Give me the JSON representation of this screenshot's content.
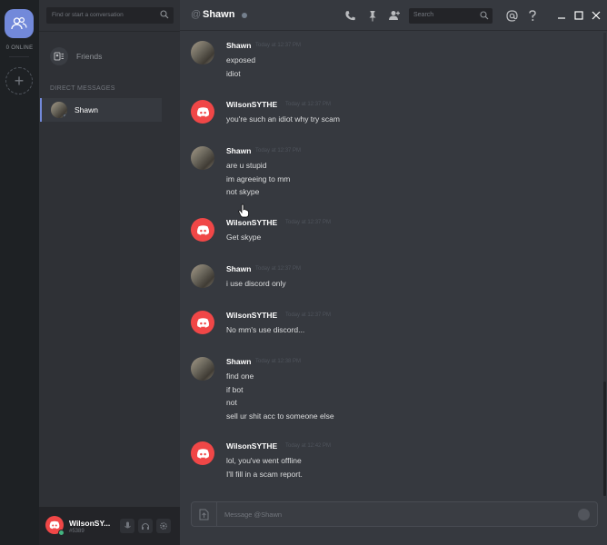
{
  "rail": {
    "online_label": "0 ONLINE",
    "add_server_symbol": "+"
  },
  "dm_panel": {
    "search_placeholder": "Find or start a conversation",
    "friends_label": "Friends",
    "section_header": "DIRECT MESSAGES",
    "dm_items": [
      {
        "label": "Shawn",
        "icon": "user-avatar"
      }
    ]
  },
  "user_panel": {
    "username": "WilsonSY...",
    "tag": "#5389",
    "status_color": "#43b581"
  },
  "header": {
    "at_symbol": "@",
    "channel_name": "Shawn",
    "search_placeholder": "Search",
    "icons": [
      "phone-icon",
      "pin-icon",
      "add-friend-icon",
      "mention-icon",
      "help-icon",
      "minimize-icon",
      "maximize-icon",
      "close-icon"
    ]
  },
  "messages": [
    {
      "author": "Shawn",
      "time": "Today at 12:37 PM",
      "avatar": "shawn",
      "lines": [
        "exposed",
        "idiot"
      ]
    },
    {
      "author": "WilsonSYTHE",
      "time": "Today at 12:37 PM",
      "avatar": "wilson",
      "lines": [
        "you're such an idiot why try scam"
      ]
    },
    {
      "author": "Shawn",
      "time": "Today at 12:37 PM",
      "avatar": "shawn",
      "lines": [
        "are u stupid",
        "im agreeing to mm",
        "not skype"
      ]
    },
    {
      "author": "WilsonSYTHE",
      "time": "Today at 12:37 PM",
      "avatar": "wilson",
      "lines": [
        "Get skype"
      ]
    },
    {
      "author": "Shawn",
      "time": "Today at 12:37 PM",
      "avatar": "shawn",
      "lines": [
        "i use discord only"
      ]
    },
    {
      "author": "WilsonSYTHE",
      "time": "Today at 12:37 PM",
      "avatar": "wilson",
      "lines": [
        "No mm's use discord..."
      ]
    },
    {
      "author": "Shawn",
      "time": "Today at 12:38 PM",
      "avatar": "shawn",
      "lines": [
        "find one",
        "if bot",
        "not",
        "sell ur shit acc to someone else"
      ]
    },
    {
      "author": "WilsonSYTHE",
      "time": "Today at 12:42 PM",
      "avatar": "wilson",
      "lines": [
        "lol, you've went offline",
        "I'll fill in a scam report."
      ]
    }
  ],
  "composer": {
    "placeholder": "Message @Shawn"
  },
  "colors": {
    "accent": "#7289da",
    "wilson_avatar": "#f04747",
    "online": "#43b581",
    "offline": "#747f8d"
  }
}
